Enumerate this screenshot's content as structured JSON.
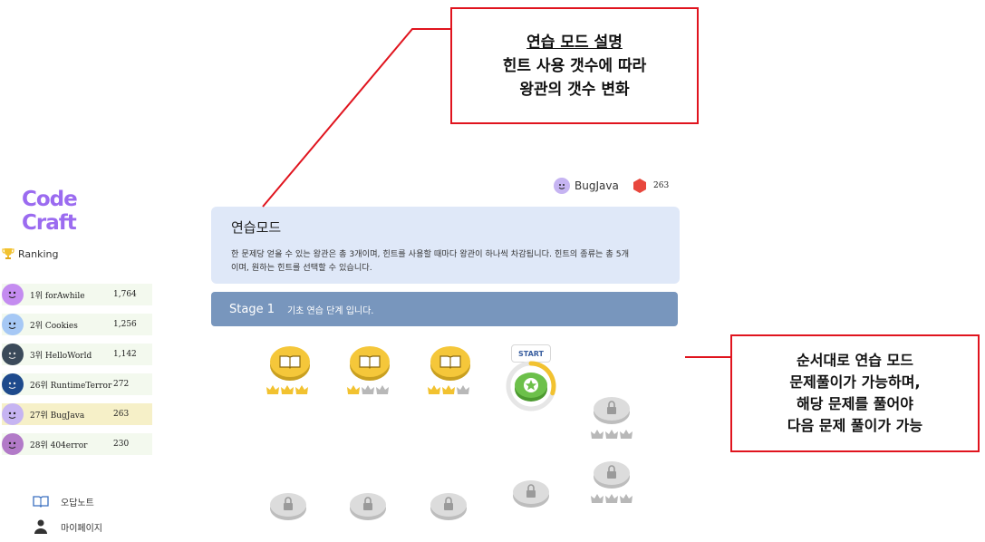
{
  "logo": "Code Craft",
  "ranking": {
    "title": "Ranking",
    "rows": [
      {
        "rank_name": "1위 forAwhile",
        "score": "1,764",
        "color": "#c48cf0"
      },
      {
        "rank_name": "2위 Cookies",
        "score": "1,256",
        "color": "#a6c8f5"
      },
      {
        "rank_name": "3위 HelloWorld",
        "score": "1,142",
        "color": "#3b4a5a"
      },
      {
        "rank_name": "26위 RuntimeTerror",
        "score": "272",
        "color": "#1e4a8c"
      },
      {
        "rank_name": "27위 BugJava",
        "score": "263",
        "color": "#c6b4f2"
      },
      {
        "rank_name": "28위 404error",
        "score": "230",
        "color": "#b27ac8"
      }
    ]
  },
  "nav": {
    "wrong_notes": "오답노트",
    "my_page": "마이페이지"
  },
  "user": {
    "name": "BugJava",
    "gems": "263"
  },
  "mode": {
    "title": "연습모드",
    "description": "한 문제당 얻을 수 있는 왕관은 총 3개이며, 힌트를 사용할 때마다 왕관이 하나씩 차감됩니다. 힌트의 종류는 총 5개이며, 원하는 힌트를 선택할 수 있습니다."
  },
  "stage": {
    "name": "Stage 1",
    "description": "기초 연습 단계 입니다."
  },
  "start_label": "START",
  "annotations": {
    "top": {
      "line1": "연습 모드 설명",
      "line2": "힌트 사용 갯수에 따라",
      "line3": "왕관의 갯수 변화"
    },
    "right": {
      "line1": "순서대로 연습 모드",
      "line2": "문제풀이가 가능하며,",
      "line3": "해당 문제를 풀어야",
      "line4": "다음 문제 풀이가 가능"
    }
  },
  "colors": {
    "brand": "#9b6bf0",
    "crown_gold": "#f2c230",
    "crown_gray": "#b8b8b8",
    "node_gold": "#f5c73a",
    "node_green": "#6cc04a",
    "locked": "#d9d9d9",
    "annotation": "#e0141e"
  },
  "nodes": [
    {
      "state": "done",
      "crowns_earned": 3
    },
    {
      "state": "done",
      "crowns_earned": 1
    },
    {
      "state": "done",
      "crowns_earned": 2
    },
    {
      "state": "current",
      "progress_percent": 30
    },
    {
      "state": "locked"
    },
    {
      "state": "locked"
    },
    {
      "state": "locked"
    },
    {
      "state": "locked"
    },
    {
      "state": "locked"
    },
    {
      "state": "locked"
    }
  ]
}
